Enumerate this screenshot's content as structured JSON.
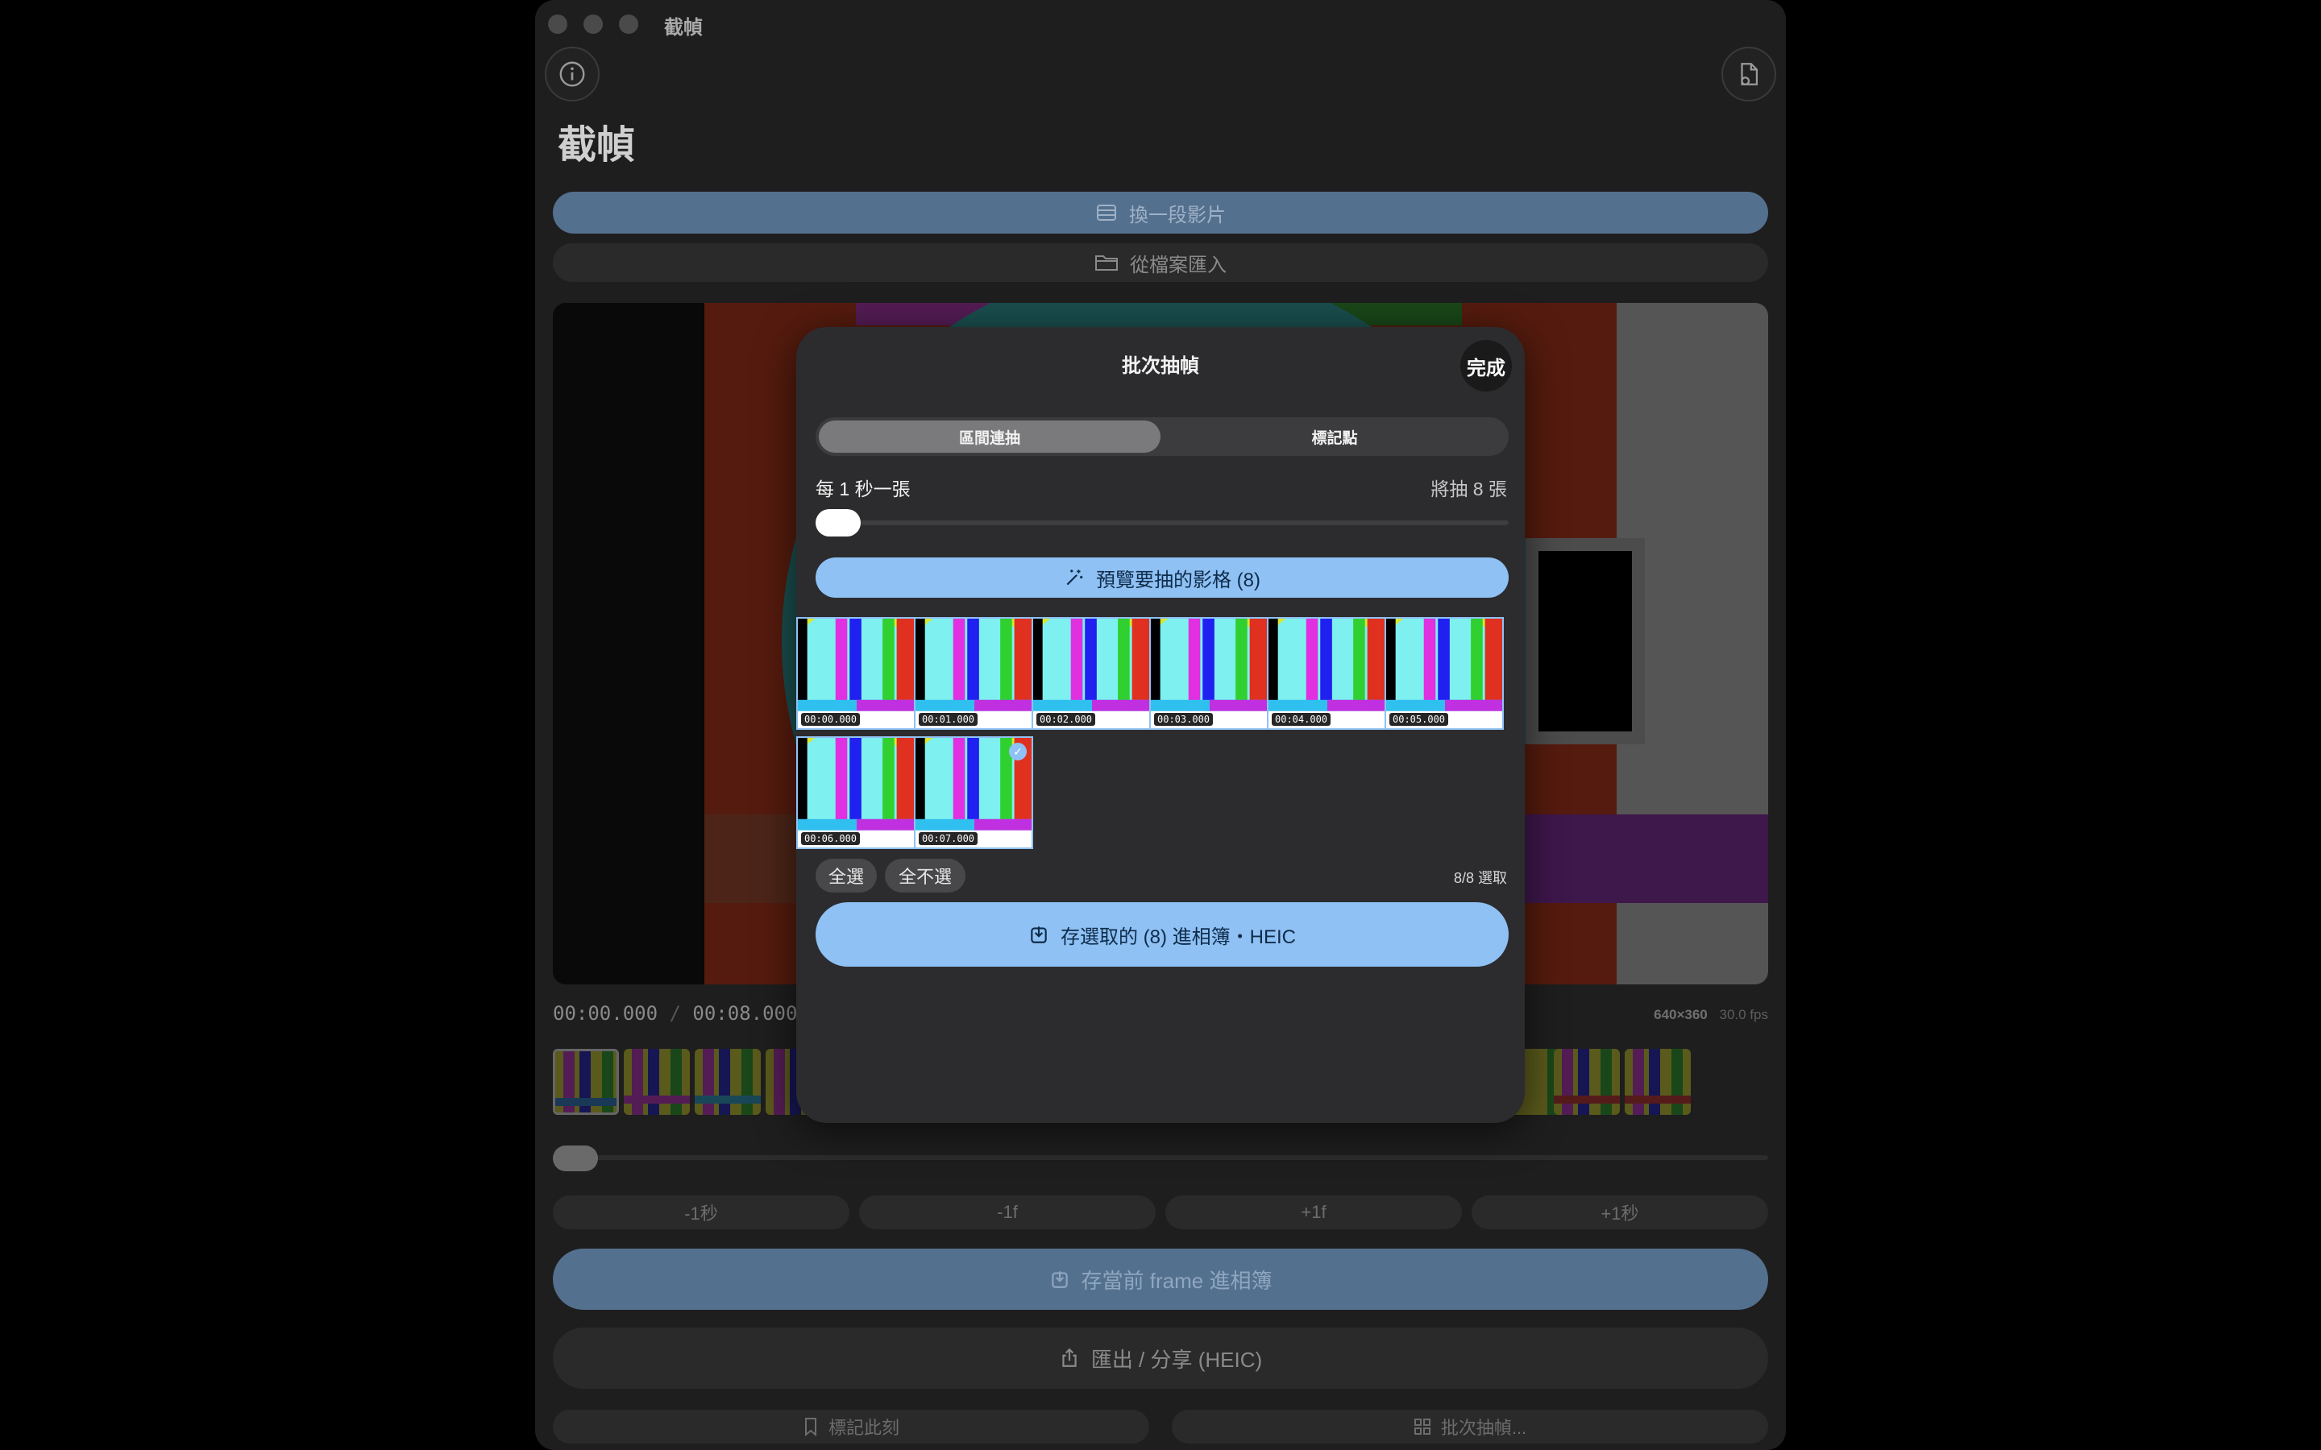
{
  "window": {
    "title": "截幀"
  },
  "header": {
    "title": "截幀",
    "info_icon": "info-icon",
    "settings_icon": "doc-gear-icon"
  },
  "actions": {
    "change_video": "換一段影片",
    "import_file": "從檔案匯入"
  },
  "player": {
    "current_time": "00:00.000",
    "separator": "/",
    "duration": "00:08.000",
    "resolution": "640×360",
    "fps": "30.0 fps"
  },
  "steps": [
    "-1秒",
    "-1f",
    "+1f",
    "+1秒"
  ],
  "buttons": {
    "save_current": "存當前 frame 進相簿",
    "export_share": "匯出 / 分享 (HEIC)",
    "mark_moment": "標記此刻",
    "batch_extract": "批次抽幀..."
  },
  "sheet": {
    "title": "批次抽幀",
    "done": "完成",
    "tabs": [
      "區間連抽",
      "標記點"
    ],
    "active_tab": 0,
    "interval_label": "每 1 秒一張",
    "count_label": "將抽 8 張",
    "interval_slider_value": 0,
    "preview_button": "預覽要抽的影格 (8)",
    "frames": [
      {
        "time": "00:00.000",
        "selected": true
      },
      {
        "time": "00:01.000",
        "selected": true
      },
      {
        "time": "00:02.000",
        "selected": true
      },
      {
        "time": "00:03.000",
        "selected": true
      },
      {
        "time": "00:04.000",
        "selected": true
      },
      {
        "time": "00:05.000",
        "selected": true
      },
      {
        "time": "00:06.000",
        "selected": true
      },
      {
        "time": "00:07.000",
        "selected": true
      }
    ],
    "select_all": "全選",
    "deselect_all": "全不選",
    "selected_count": "8/8 選取",
    "save_selected": "存選取的 (8) 進相簿・HEIC"
  },
  "colors": {
    "accent": "#8fc1f4",
    "accent_dim": "#54708f",
    "sheet_bg": "#2c2c2e",
    "window_bg": "#1e1e1e"
  }
}
